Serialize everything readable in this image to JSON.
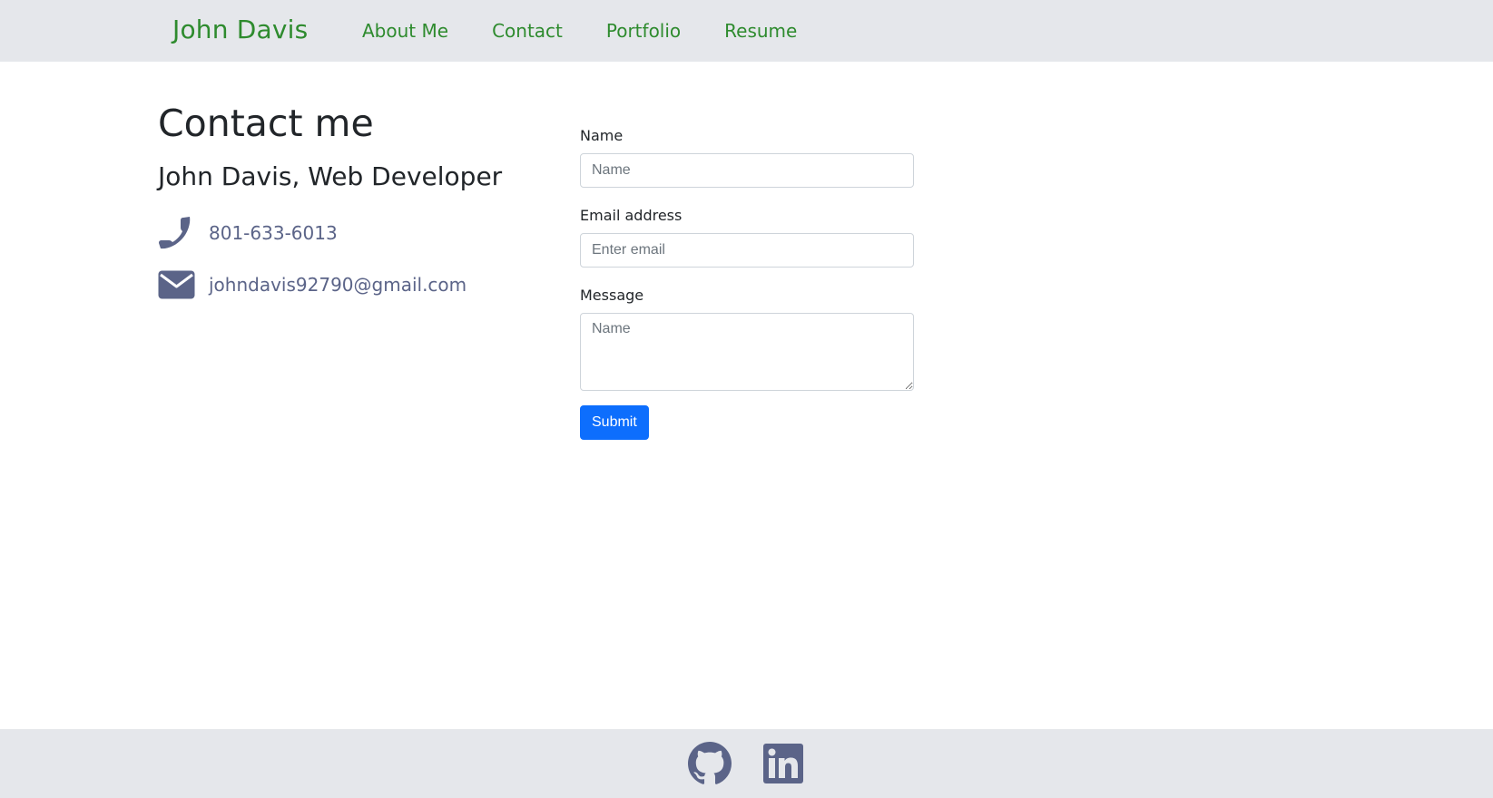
{
  "nav": {
    "brand": "John Davis",
    "links": [
      "About Me",
      "Contact",
      "Portfolio",
      "Resume"
    ]
  },
  "contact": {
    "title": "Contact me",
    "subtitle": "John Davis, Web Developer",
    "phone": "801-633-6013",
    "email": "johndavis92790@gmail.com",
    "phone_icon": "phone-icon",
    "email_icon": "envelope-icon"
  },
  "form": {
    "name_label": "Name",
    "name_placeholder": "Name",
    "email_label": "Email address",
    "email_placeholder": "Enter email",
    "message_label": "Message",
    "message_placeholder": "Name",
    "submit_label": "Submit"
  },
  "footer": {
    "icons": [
      "github-icon",
      "linkedin-icon"
    ]
  },
  "colors": {
    "brand_green": "#2e8b2e",
    "nav_bg": "#e5e7eb",
    "icon_slate": "#5b6488",
    "primary_button": "#0d6efd"
  }
}
